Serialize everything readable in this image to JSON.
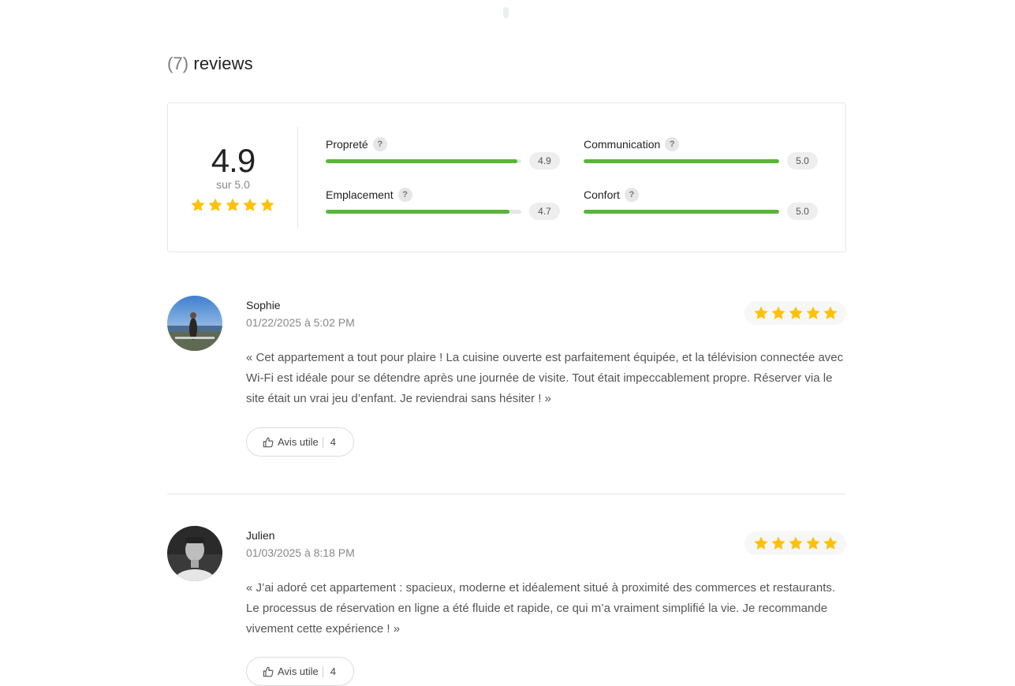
{
  "reviews_header": {
    "count": "(7)",
    "label": "reviews"
  },
  "summary": {
    "score": "4.9",
    "subtitle": "sur 5.0",
    "stars": 5,
    "categories": [
      {
        "label": "Propreté",
        "value": "4.9",
        "fraction": 0.98
      },
      {
        "label": "Communication",
        "value": "5.0",
        "fraction": 1.0
      },
      {
        "label": "Emplacement",
        "value": "4.7",
        "fraction": 0.94
      },
      {
        "label": "Confort",
        "value": "5.0",
        "fraction": 1.0
      }
    ],
    "help_glyph": "?"
  },
  "reviews": [
    {
      "name": "Sophie",
      "date": "01/22/2025 à 5:02 PM",
      "rating": 5,
      "text": "« Cet appartement a tout pour plaire ! La cuisine ouverte est parfaitement équipée, et la télévision connectée avec Wi-Fi est idéale pour se détendre après une journée de visite. Tout était impeccablement propre. Réserver via le site était un vrai jeu d’enfant. Je reviendrai sans hésiter ! »",
      "helpful_label": "Avis utile",
      "helpful_count": "4"
    },
    {
      "name": "Julien",
      "date": "01/03/2025 à 8:18 PM",
      "rating": 5,
      "text": "« J’ai adoré cet appartement : spacieux, moderne et idéalement situé à proximité des commerces et restaurants. Le processus de réservation en ligne a été fluide et rapide, ce qui m’a vraiment simplifié la vie. Je recommande vivement cette expérience ! »",
      "helpful_label": "Avis utile",
      "helpful_count": "4"
    }
  ],
  "colors": {
    "star": "#FFC107",
    "bar": "#5AB53A",
    "track": "#E6E6E6"
  },
  "icons": {
    "star": "star-icon",
    "help": "question-icon",
    "thumb": "thumbs-up-icon"
  }
}
